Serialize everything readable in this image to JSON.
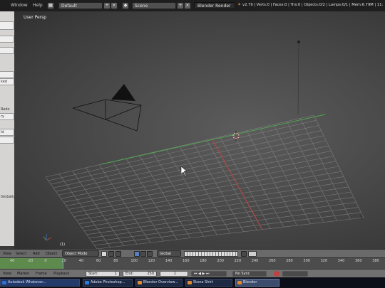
{
  "topbar": {
    "menus": [
      "Window",
      "Help"
    ],
    "screen_layout": "Default",
    "scene": "Scene",
    "render_engine": "Blender Render",
    "stats": "v2.79 | Verts:0 | Faces:0 | Tris:0 | Objects:0/2 | Lamps:0/1 | Mem:6.79M | 11:"
  },
  "shelf": {
    "labels": [
      "ked",
      "Redo",
      "ry",
      "ld",
      "Globally"
    ]
  },
  "viewport": {
    "title": "User Persp",
    "frame_label": "(1)"
  },
  "view3d_header": {
    "menus": [
      "View",
      "Select",
      "Add",
      "Object"
    ],
    "mode": "Object Mode",
    "pivot": "Global"
  },
  "timeline": {
    "ticks": [
      "40",
      "-20",
      "0",
      "20",
      "40",
      "60",
      "80",
      "100",
      "120",
      "140",
      "160",
      "180",
      "200",
      "220",
      "240",
      "260",
      "280",
      "300",
      "320",
      "340",
      "360",
      "380"
    ]
  },
  "timeline_header": {
    "menus": [
      "View",
      "Marker",
      "Frame",
      "Playback"
    ],
    "start": "Start:",
    "start_value": "1",
    "end": "End:",
    "end_value": "250",
    "current": "1",
    "sync": "No Sync"
  },
  "taskbar": {
    "items": [
      "Autodesk Whatever...",
      "Adobe Photoshop...",
      "Blender Overview...",
      "Stone Shirt",
      "Blender"
    ]
  },
  "colors": {
    "x_axis": "#c94646",
    "y_axis": "#4fa84f",
    "frame_range": "#5f8a4d",
    "header_bg": "#1e1e1e"
  }
}
